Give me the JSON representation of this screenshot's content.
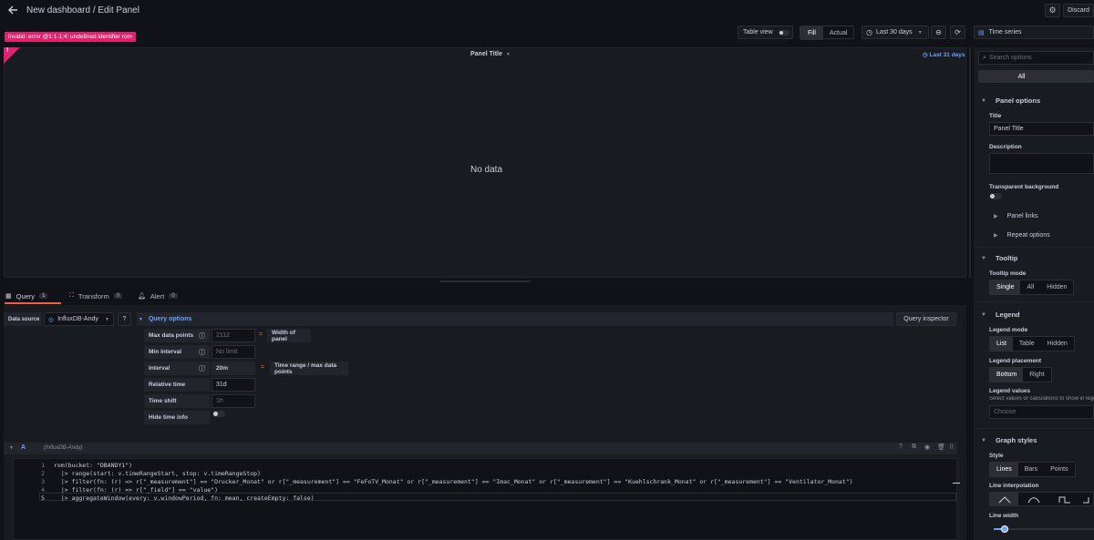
{
  "header": {
    "title": "New dashboard / Edit Panel",
    "discard_label": "Discard"
  },
  "toolbar": {
    "table_view_label": "Table view",
    "fill_label": "Fill",
    "actual_label": "Actual",
    "time_range_label": "Last 30 days",
    "viz_label": "Time series"
  },
  "panel": {
    "error_text": "invalid: error @1:1-1:4: undefined identifier rom",
    "error_badge": "!",
    "title": "Panel Title",
    "time_override": "Last 31 days",
    "no_data": "No data"
  },
  "tabs": [
    {
      "label": "Query",
      "count": "1"
    },
    {
      "label": "Transform",
      "count": "0"
    },
    {
      "label": "Alert",
      "count": "0"
    }
  ],
  "query": {
    "data_source_label": "Data source",
    "data_source_value": "InfluxDB-Andy",
    "query_options_label": "Query options",
    "query_inspector_label": "Query inspector",
    "options": {
      "max_data_points_label": "Max data points",
      "max_data_points_value": "2112",
      "max_data_points_hint": "Width of panel",
      "min_interval_label": "Min interval",
      "min_interval_placeholder": "No limit",
      "interval_label": "Interval",
      "interval_value": "20m",
      "interval_hint": "Time range / max data points",
      "relative_time_label": "Relative time",
      "relative_time_value": "31d",
      "time_shift_label": "Time shift",
      "time_shift_placeholder": "1h",
      "hide_time_info_label": "Hide time info",
      "equals_sign": "="
    },
    "query_row": {
      "letter": "A",
      "source": "(InfluxDB-Andy)"
    },
    "code": [
      {
        "n": "1",
        "text": "rom(bucket: \"DBANDY1\")"
      },
      {
        "n": "2",
        "text": "  |> range(start: v.timeRangeStart, stop: v.timeRangeStop)"
      },
      {
        "n": "3",
        "text": "  |> filter(fn: (r) => r[\"_measurement\"] == \"Drucker_Monat\" or r[\"_measurement\"] == \"FeFoTV_Monat\" or r[\"_measurement\"] == \"Imac_Monat\" or r[\"_measurement\"] == \"Kuehlschrank_Monat\" or r[\"_measurement\"] == \"Ventilator_Monat\")"
      },
      {
        "n": "4",
        "text": "  |> filter(fn: (r) => r[\"_field\"] == \"value\")"
      },
      {
        "n": "5",
        "text": "  |> aggregateWindow(every: v.windowPeriod, fn: mean, createEmpty: false)"
      }
    ]
  },
  "options_pane": {
    "search_placeholder": "Search options",
    "all_tab": "All",
    "panel_options": {
      "header": "Panel options",
      "title_label": "Title",
      "title_value": "Panel Title",
      "description_label": "Description",
      "transparent_label": "Transparent background",
      "panel_links": "Panel links",
      "repeat_options": "Repeat options"
    },
    "tooltip": {
      "header": "Tooltip",
      "mode_label": "Tooltip mode",
      "modes": [
        "Single",
        "All",
        "Hidden"
      ]
    },
    "legend": {
      "header": "Legend",
      "mode_label": "Legend mode",
      "modes": [
        "List",
        "Table",
        "Hidden"
      ],
      "placement_label": "Legend placement",
      "placements": [
        "Bottom",
        "Right"
      ],
      "values_label": "Legend values",
      "values_desc": "Select values or calculations to show in legend",
      "values_placeholder": "Choose"
    },
    "graph_styles": {
      "header": "Graph styles",
      "style_label": "Style",
      "styles": [
        "Lines",
        "Bars",
        "Points"
      ],
      "interpolation_label": "Line interpolation",
      "line_width_label": "Line width"
    }
  },
  "colors": {
    "bg": "#111217",
    "panel": "#181b1f",
    "error": "#e0226e",
    "accent": "#6e9fff",
    "tab_active": "#f55f3e"
  }
}
